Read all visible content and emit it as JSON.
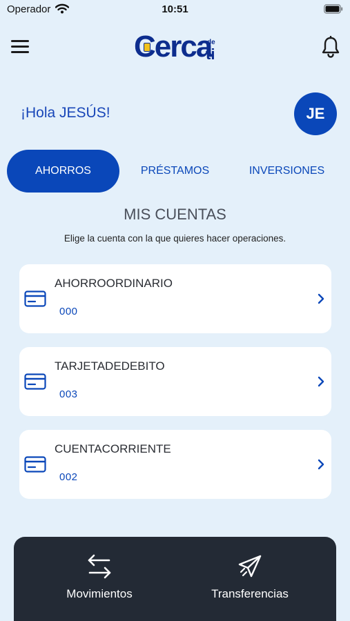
{
  "status_bar": {
    "carrier": "Operador",
    "time": "10:51"
  },
  "header": {
    "logo_main": "Cerca",
    "logo_de": "de",
    "logo_ti": "ti"
  },
  "greeting": "¡Hola JESÚS!",
  "avatar_initials": "JE",
  "tabs": [
    {
      "label": "AHORROS",
      "active": true
    },
    {
      "label": "PRÉSTAMOS",
      "active": false
    },
    {
      "label": "INVERSIONES",
      "active": false
    }
  ],
  "section": {
    "title": "MIS CUENTAS",
    "subtitle": "Elige la cuenta con la que quieres hacer operaciones."
  },
  "accounts": [
    {
      "name": "AHORROORDINARIO",
      "number": "000",
      "icon": "credit-card-icon"
    },
    {
      "name": "TARJETADEDEBITO",
      "number": "003",
      "icon": "credit-card-icon"
    },
    {
      "name": "CUENTACORRIENTE",
      "number": "002",
      "icon": "credit-card-icon"
    }
  ],
  "bottom_nav": [
    {
      "label": "Movimientos",
      "icon": "arrows-swap-icon"
    },
    {
      "label": "Transferencias",
      "icon": "paper-plane-icon"
    }
  ],
  "colors": {
    "background": "#e4f0fa",
    "primary": "#0a47b9",
    "bottom_bar": "#232a35",
    "card": "#ffffff"
  }
}
